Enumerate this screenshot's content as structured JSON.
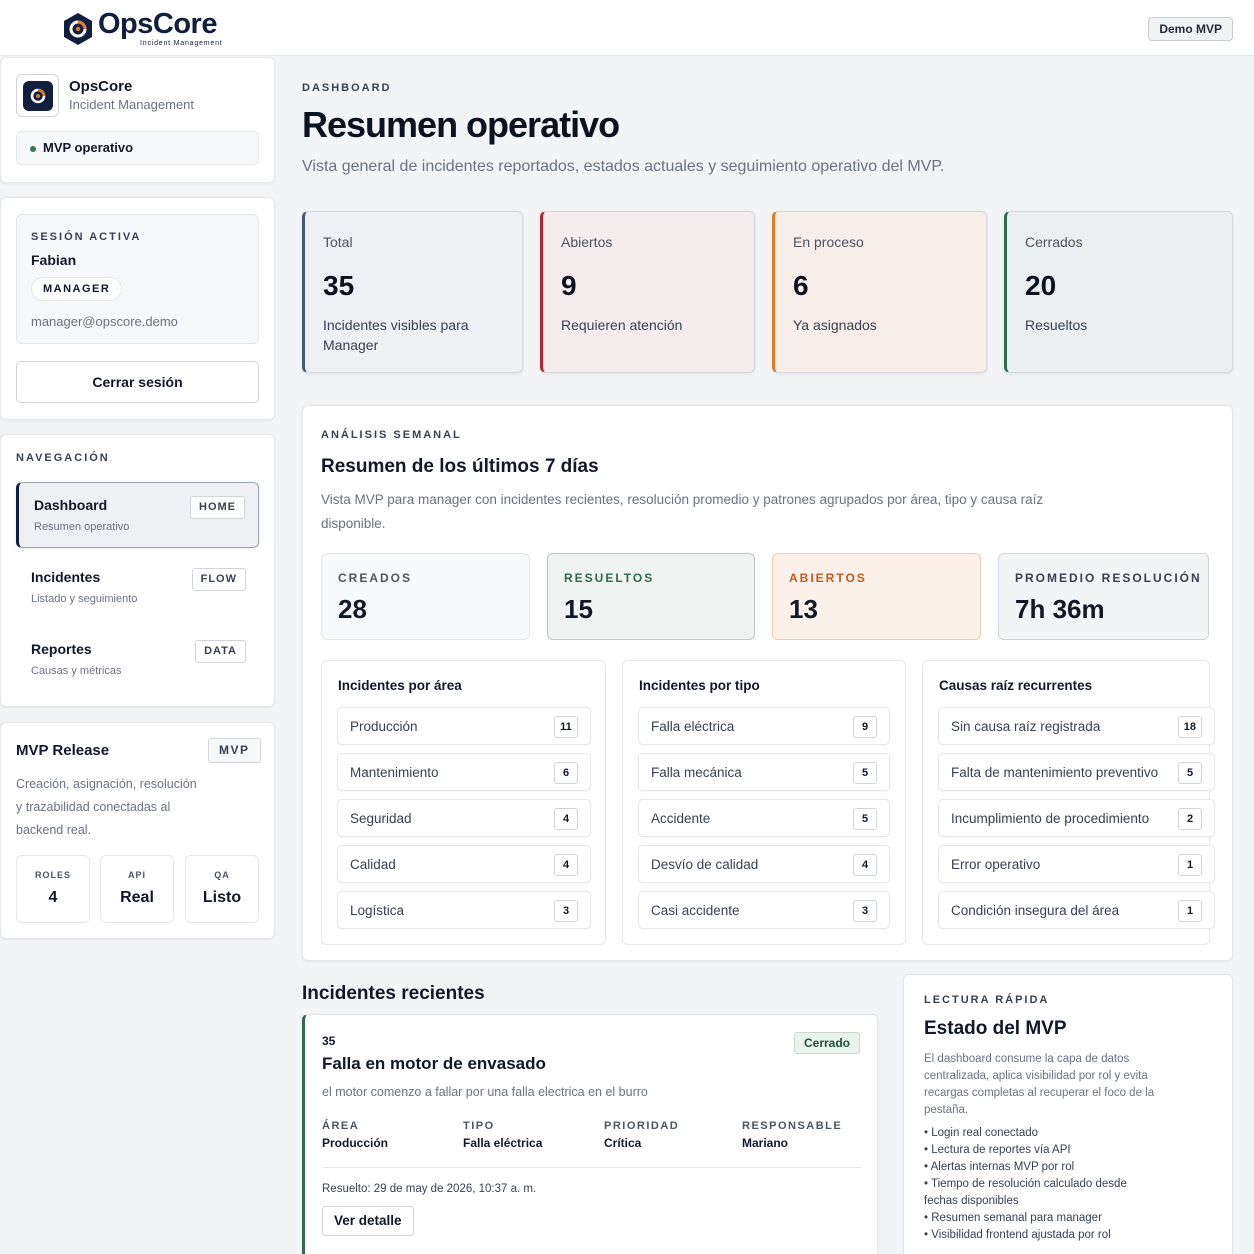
{
  "topbar": {
    "brand_name": "OpsCore",
    "brand_tagline": "Incident Management",
    "demo_badge": "Demo MVP"
  },
  "sidebar": {
    "brand": {
      "title": "OpsCore",
      "subtitle": "Incident Management",
      "status": "MVP operativo"
    },
    "session": {
      "label": "Sesión activa",
      "user": "Fabian",
      "role": "MANAGER",
      "email": "manager@opscore.demo",
      "logout_label": "Cerrar sesión"
    },
    "nav": {
      "label": "Navegación",
      "items": [
        {
          "title": "Dashboard",
          "sub": "Resumen operativo",
          "tag": "HOME"
        },
        {
          "title": "Incidentes",
          "sub": "Listado y seguimiento",
          "tag": "FLOW"
        },
        {
          "title": "Reportes",
          "sub": "Causas y métricas",
          "tag": "DATA"
        }
      ]
    },
    "release": {
      "title": "MVP Release",
      "tag": "MVP",
      "description": "Creación, asignación, resolución y trazabilidad conectadas al backend real.",
      "stats": [
        {
          "label": "ROLES",
          "value": "4"
        },
        {
          "label": "API",
          "value": "Real"
        },
        {
          "label": "QA",
          "value": "Listo"
        }
      ]
    }
  },
  "main": {
    "eyebrow": "Dashboard",
    "title": "Resumen operativo",
    "description": "Vista general de incidentes reportados, estados actuales y seguimiento operativo del MVP.",
    "kpis": [
      {
        "label": "Total",
        "value": "35",
        "desc": "Incidentes visibles para Manager",
        "accent": "#4b5a72",
        "bg": "#eef0f3"
      },
      {
        "label": "Abiertos",
        "value": "9",
        "desc": "Requieren atención",
        "accent": "#b4232f",
        "bg": "#f5ecee"
      },
      {
        "label": "En proceso",
        "value": "6",
        "desc": "Ya asignados",
        "accent": "#e07b2a",
        "bg": "#f7eeea"
      },
      {
        "label": "Cerrados",
        "value": "20",
        "desc": "Resueltos",
        "accent": "#2f6b4a",
        "bg": "#ebeff0"
      }
    ]
  },
  "weekly": {
    "eyebrow": "Análisis semanal",
    "title": "Resumen de los últimos 7 días",
    "description": "Vista MVP para manager con incidentes recientes, resolución promedio y patrones agrupados por área, tipo y causa raíz disponible.",
    "stats": [
      {
        "label": "CREADOS",
        "value": "28",
        "color": "#4b5563",
        "bg": "#f8f9fa",
        "border": "#e5e7eb"
      },
      {
        "label": "RESUELTOS",
        "value": "15",
        "color": "#2f6b4a",
        "bg": "#eff3f1",
        "border": "#b8c9bf"
      },
      {
        "label": "ABIERTOS",
        "value": "13",
        "color": "#c25a1e",
        "bg": "#fbf0ea",
        "border": "#f1c9b0"
      },
      {
        "label": "PROMEDIO RESOLUCIÓN",
        "value": "7h 36m",
        "color": "#374151",
        "bg": "#f3f4f6",
        "border": "#d1d5db"
      }
    ],
    "lists": [
      {
        "title": "Incidentes por área",
        "rows": [
          {
            "label": "Producción",
            "count": "11"
          },
          {
            "label": "Mantenimiento",
            "count": "6"
          },
          {
            "label": "Seguridad",
            "count": "4"
          },
          {
            "label": "Calidad",
            "count": "4"
          },
          {
            "label": "Logística",
            "count": "3"
          }
        ]
      },
      {
        "title": "Incidentes por tipo",
        "rows": [
          {
            "label": "Falla eléctrica",
            "count": "9"
          },
          {
            "label": "Falla mecánica",
            "count": "5"
          },
          {
            "label": "Accidente",
            "count": "5"
          },
          {
            "label": "Desvío de calidad",
            "count": "4"
          },
          {
            "label": "Casi accidente",
            "count": "3"
          }
        ]
      },
      {
        "title": "Causas raíz recurrentes",
        "rows": [
          {
            "label": "Sin causa raíz registrada",
            "count": "18"
          },
          {
            "label": "Falta de mantenimiento preventivo",
            "count": "5"
          },
          {
            "label": "Incumplimiento de procedimiento",
            "count": "2"
          },
          {
            "label": "Error operativo",
            "count": "1"
          },
          {
            "label": "Condición insegura del área",
            "count": "1"
          }
        ]
      }
    ]
  },
  "recent": {
    "title": "Incidentes recientes",
    "incident": {
      "id": "35",
      "status": "Cerrado",
      "title": "Falla en motor de envasado",
      "description": "el motor comenzo a fallar por una falla electrica en el burro",
      "fields": [
        {
          "label": "ÁREA",
          "value": "Producción"
        },
        {
          "label": "TIPO",
          "value": "Falla eléctrica"
        },
        {
          "label": "PRIORIDAD",
          "value": "Crítica"
        },
        {
          "label": "RESPONSABLE",
          "value": "Mariano"
        }
      ],
      "resolved": "Resuelto: 29 de may de 2026, 10:37 a. m.",
      "button": "Ver detalle"
    }
  },
  "quick": {
    "eyebrow": "Lectura rápida",
    "title": "Estado del MVP",
    "description": "El dashboard consume la capa de datos centralizada, aplica visibilidad por rol y evita recargas completas al recuperar el foco de la pestaña.",
    "items": [
      "Login real conectado",
      "Lectura de reportes vía API",
      "Alertas internas MVP por rol",
      "Tiempo de resolución calculado desde fechas disponibles",
      "Resumen semanal para manager",
      "Visibilidad frontend ajustada por rol"
    ]
  }
}
